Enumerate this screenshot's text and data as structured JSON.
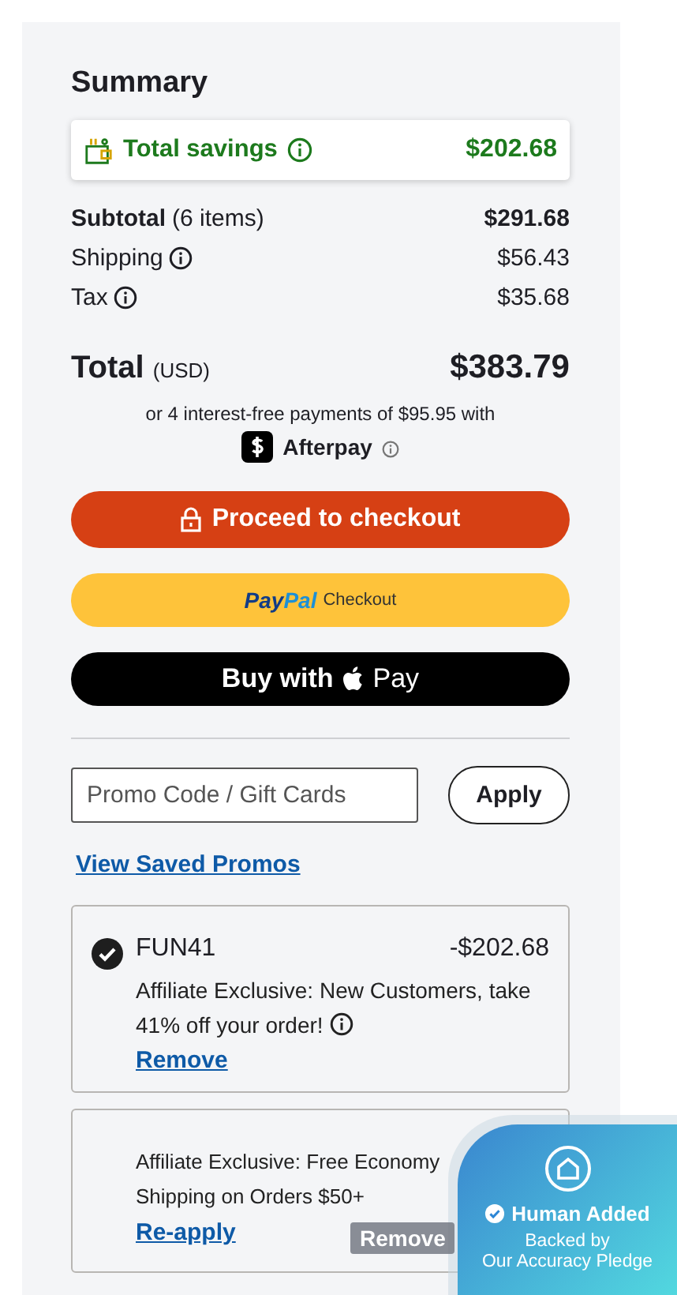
{
  "summary": {
    "title": "Summary",
    "savings": {
      "label": "Total savings",
      "amount": "$202.68"
    },
    "lines": [
      {
        "label": "Subtotal",
        "note": "(6 items)",
        "amount": "$291.68",
        "info": false,
        "bold": true
      },
      {
        "label": "Shipping",
        "amount": "$56.43",
        "info": true,
        "bold": false
      },
      {
        "label": "Tax",
        "amount": "$35.68",
        "info": true,
        "bold": false
      }
    ],
    "total": {
      "label": "Total",
      "note": "(USD)",
      "amount": "$383.79"
    },
    "installments": {
      "text": "or 4 interest-free payments of $95.95 with",
      "provider": "Afterpay"
    }
  },
  "buttons": {
    "checkout": "Proceed to checkout",
    "paypal": {
      "brand_first": "Pay",
      "brand_second": "Pal",
      "label": "Checkout"
    },
    "apple_pay": {
      "label": "Buy with",
      "brand": "Pay"
    }
  },
  "promo": {
    "placeholder": "Promo Code / Gift Cards",
    "apply": "Apply",
    "saved_link": "View Saved Promos"
  },
  "coupons": [
    {
      "applied": true,
      "code": "FUN41",
      "amount": "-$202.68",
      "description": "Affiliate Exclusive: New Customers, take 41% off your order!",
      "info": true,
      "action": "Remove"
    },
    {
      "applied": false,
      "description": "Affiliate Exclusive: Free Economy Shipping on Orders $50+",
      "info": false,
      "action": "Re-apply"
    }
  ],
  "overlay": {
    "badge": "Human Added",
    "subtitle_1": "Backed by",
    "subtitle_2": "Our Accuracy Pledge",
    "tooltip": "Remove"
  }
}
